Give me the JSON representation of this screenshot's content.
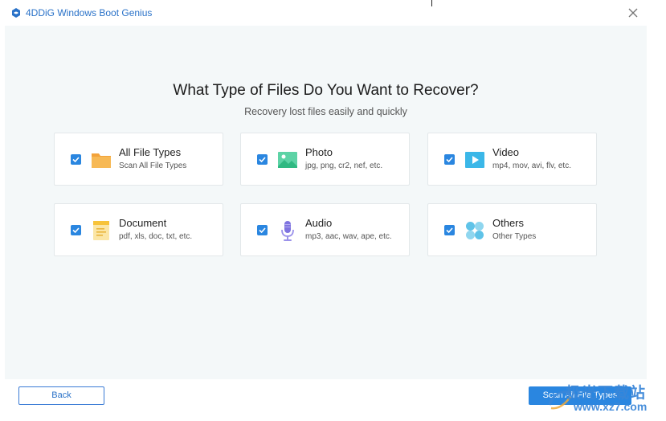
{
  "window": {
    "title": "4DDiG Windows Boot Genius",
    "close_icon": "close-icon"
  },
  "main": {
    "headline": "What Type of Files Do You Want to Recover?",
    "subline": "Recovery lost files easily and quickly",
    "file_types": [
      {
        "title": "All File Types",
        "desc": "Scan All File Types",
        "checked": true,
        "icon": "folder-icon"
      },
      {
        "title": "Photo",
        "desc": "jpg, png, cr2, nef, etc.",
        "checked": true,
        "icon": "photo-icon"
      },
      {
        "title": "Video",
        "desc": "mp4, mov, avi, flv, etc.",
        "checked": true,
        "icon": "video-icon"
      },
      {
        "title": "Document",
        "desc": "pdf, xls, doc, txt, etc.",
        "checked": true,
        "icon": "document-icon"
      },
      {
        "title": "Audio",
        "desc": "mp3, aac, wav, ape, etc.",
        "checked": true,
        "icon": "microphone-icon"
      },
      {
        "title": "Others",
        "desc": "Other Types",
        "checked": true,
        "icon": "others-icon"
      }
    ]
  },
  "footer": {
    "back_label": "Back",
    "scan_label": "Scan All File Types"
  },
  "watermark": {
    "cn_text": "极光下载站",
    "url": "www.xz7.com"
  },
  "colors": {
    "accent": "#2a86e0",
    "content_bg": "#f4f8f9",
    "title_text": "#2a72c8"
  }
}
